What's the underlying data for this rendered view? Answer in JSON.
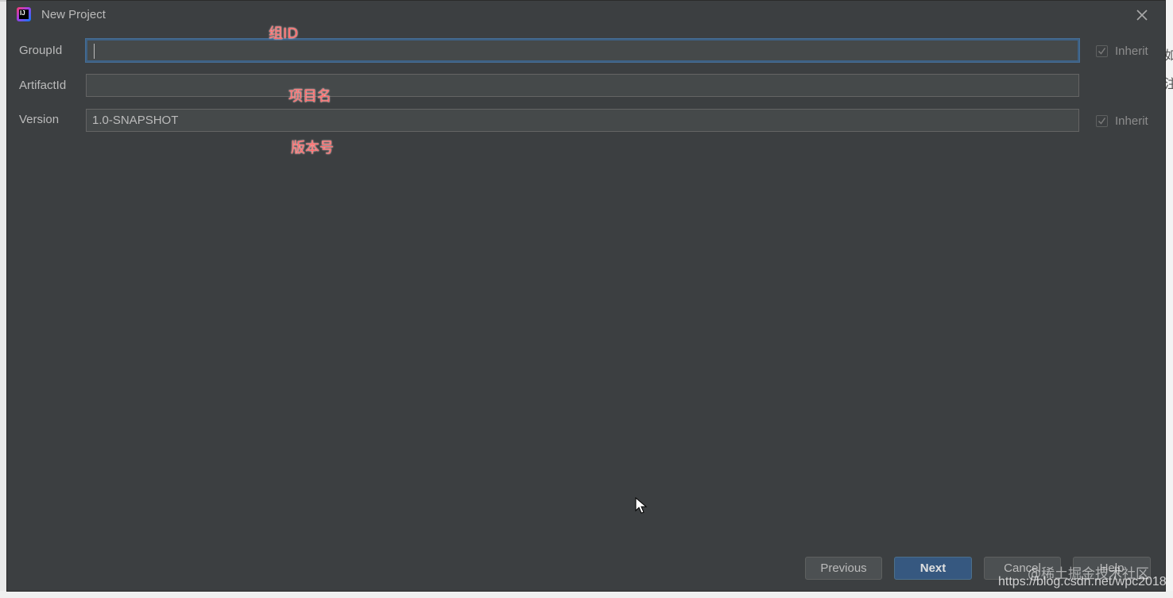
{
  "window": {
    "title": "New Project",
    "app_icon": "intellij-idea-icon",
    "close_icon": "close-icon"
  },
  "fields": [
    {
      "label": "GroupId",
      "value": "",
      "focused": true,
      "inherit_label": "Inherit",
      "inherit_checked": true
    },
    {
      "label": "ArtifactId",
      "value": ""
    },
    {
      "label": "Version",
      "value": "1.0-SNAPSHOT",
      "inherit_label": "Inherit",
      "inherit_checked": true
    }
  ],
  "annotations": {
    "group": "组ID",
    "artifact": "项目名",
    "version": "版本号"
  },
  "buttons": {
    "previous": "Previous",
    "next": "Next",
    "cancel": "Cancel",
    "help": "Help"
  },
  "watermark": {
    "line1": "@稀土掘金技术社区",
    "line2": "https://blog.csdn.net/wpc2018"
  },
  "colors": {
    "dialog_bg": "#3c3f41",
    "field_bg": "#45494a",
    "focus_border": "#3d6185",
    "primary_button": "#365880",
    "annotation_text": "#ff6b6b"
  }
}
